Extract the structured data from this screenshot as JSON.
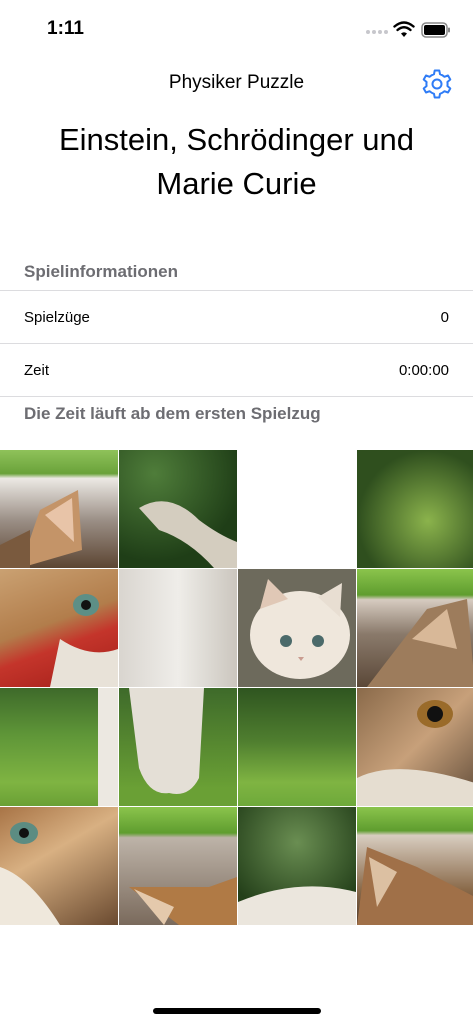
{
  "status": {
    "time": "1:11"
  },
  "nav": {
    "title": "Physiker Puzzle",
    "settings_icon": "gear-icon",
    "accent": "#2f7cf6"
  },
  "header": {
    "title_line1": "Einstein, Schrödinger und",
    "title_line2": "Marie Curie"
  },
  "info": {
    "section_title": "Spielinformationen",
    "moves_label": "Spielzüge",
    "moves_value": "0",
    "time_label": "Zeit",
    "time_value": "0:00:00",
    "footer": "Die Zeit läuft ab dem ersten Spielzug"
  },
  "puzzle": {
    "tiles": [
      "tile-1",
      "tile-2",
      "empty",
      "tile-4",
      "tile-5",
      "tile-6",
      "tile-7",
      "tile-8",
      "tile-9",
      "tile-10",
      "tile-11",
      "tile-12",
      "tile-13",
      "tile-14",
      "tile-15",
      "tile-16"
    ]
  }
}
